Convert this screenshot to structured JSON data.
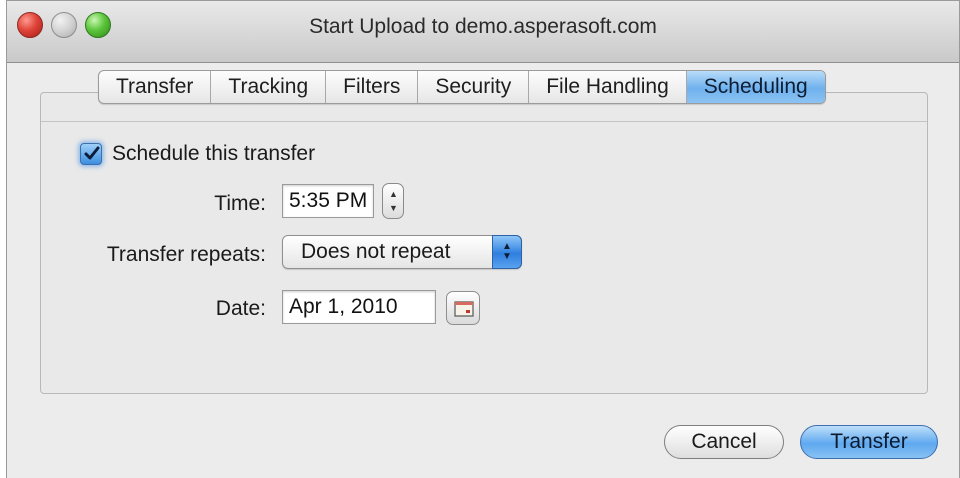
{
  "window": {
    "title": "Start Upload to demo.asperasoft.com"
  },
  "tabs": [
    {
      "label": "Transfer",
      "active": false
    },
    {
      "label": "Tracking",
      "active": false
    },
    {
      "label": "Filters",
      "active": false
    },
    {
      "label": "Security",
      "active": false
    },
    {
      "label": "File Handling",
      "active": false
    },
    {
      "label": "Scheduling",
      "active": true
    }
  ],
  "scheduling": {
    "schedule_checkbox": {
      "label": "Schedule this transfer",
      "checked": true
    },
    "time": {
      "label": "Time:",
      "value": "5:35 PM"
    },
    "repeats": {
      "label": "Transfer repeats:",
      "value": "Does not repeat"
    },
    "date": {
      "label": "Date:",
      "value": "Apr 1, 2010"
    }
  },
  "buttons": {
    "cancel": "Cancel",
    "transfer": "Transfer"
  },
  "icons": {
    "close": "close-window-icon",
    "minimize": "minimize-window-icon",
    "zoom": "zoom-window-icon",
    "checkmark": "checkmark-icon",
    "stepper": "stepper-arrows-icon",
    "popup_arrows": "popup-arrows-icon",
    "calendar": "calendar-icon"
  },
  "colors": {
    "accent": "#6fb1ee",
    "window_bg": "#ececec"
  }
}
